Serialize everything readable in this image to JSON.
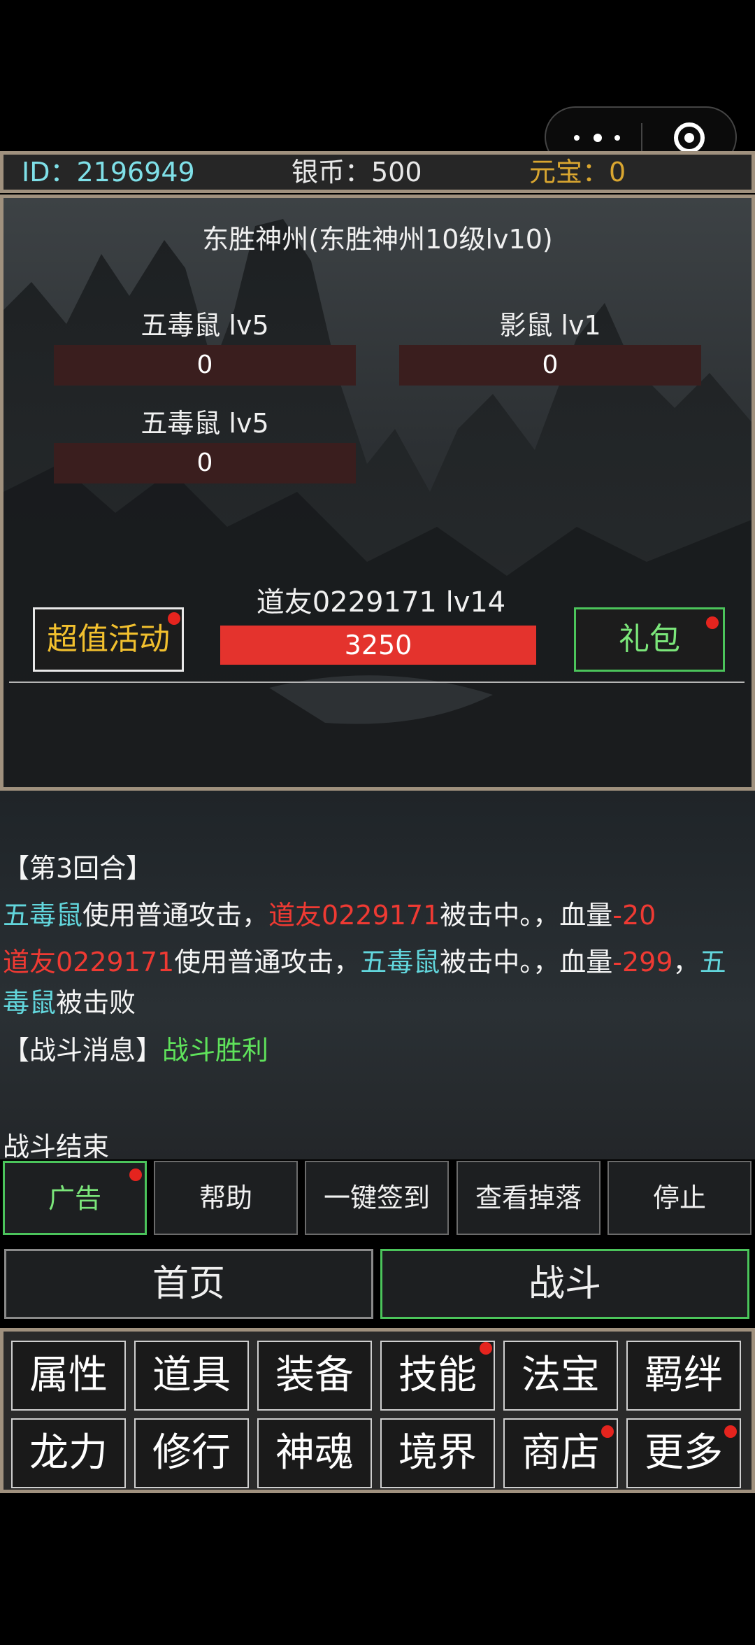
{
  "colors": {
    "accent_green": "#4bc45b",
    "hp_red": "#e4332d",
    "frame": "#a0917e",
    "notice_dot": "#e5241e"
  },
  "header": {
    "id": "ID：2196949",
    "silver": "银币：500",
    "ingot": "元宝：0"
  },
  "scene": {
    "location": "东胜神州(东胜神州10级lv10)",
    "enemies": [
      {
        "name": "五毒鼠 lv5",
        "hp": "0"
      },
      {
        "name": "影鼠 lv1",
        "hp": "0"
      },
      {
        "name": "五毒鼠 lv5",
        "hp": "0"
      }
    ],
    "player": {
      "name": "道友0229171 lv14",
      "hp": "3250"
    },
    "event_button": "超值活动",
    "gift_button": "礼包"
  },
  "log": {
    "round": "【第3回合】",
    "l1": {
      "a": "五毒鼠",
      "b": "使用普通攻击，",
      "c": "道友0229171",
      "d": "被击中。，血量",
      "e": "-20"
    },
    "l2": {
      "a": "道友0229171",
      "b": "使用普通攻击，",
      "c": "五毒鼠",
      "d": "被击中。，血量",
      "e": "-299",
      "f": "，",
      "g": "五"
    },
    "l3": {
      "a": "毒鼠",
      "b": "被击败"
    },
    "msg": {
      "label": "【战斗消息】",
      "value": "战斗胜利"
    },
    "end": "战斗结束"
  },
  "actions": [
    "广告",
    "帮助",
    "一键签到",
    "查看掉落",
    "停止"
  ],
  "nav": {
    "home": "首页",
    "battle": "战斗"
  },
  "menu": [
    "属性",
    "道具",
    "装备",
    "技能",
    "法宝",
    "羁绊",
    "龙力",
    "修行",
    "神魂",
    "境界",
    "商店",
    "更多"
  ]
}
